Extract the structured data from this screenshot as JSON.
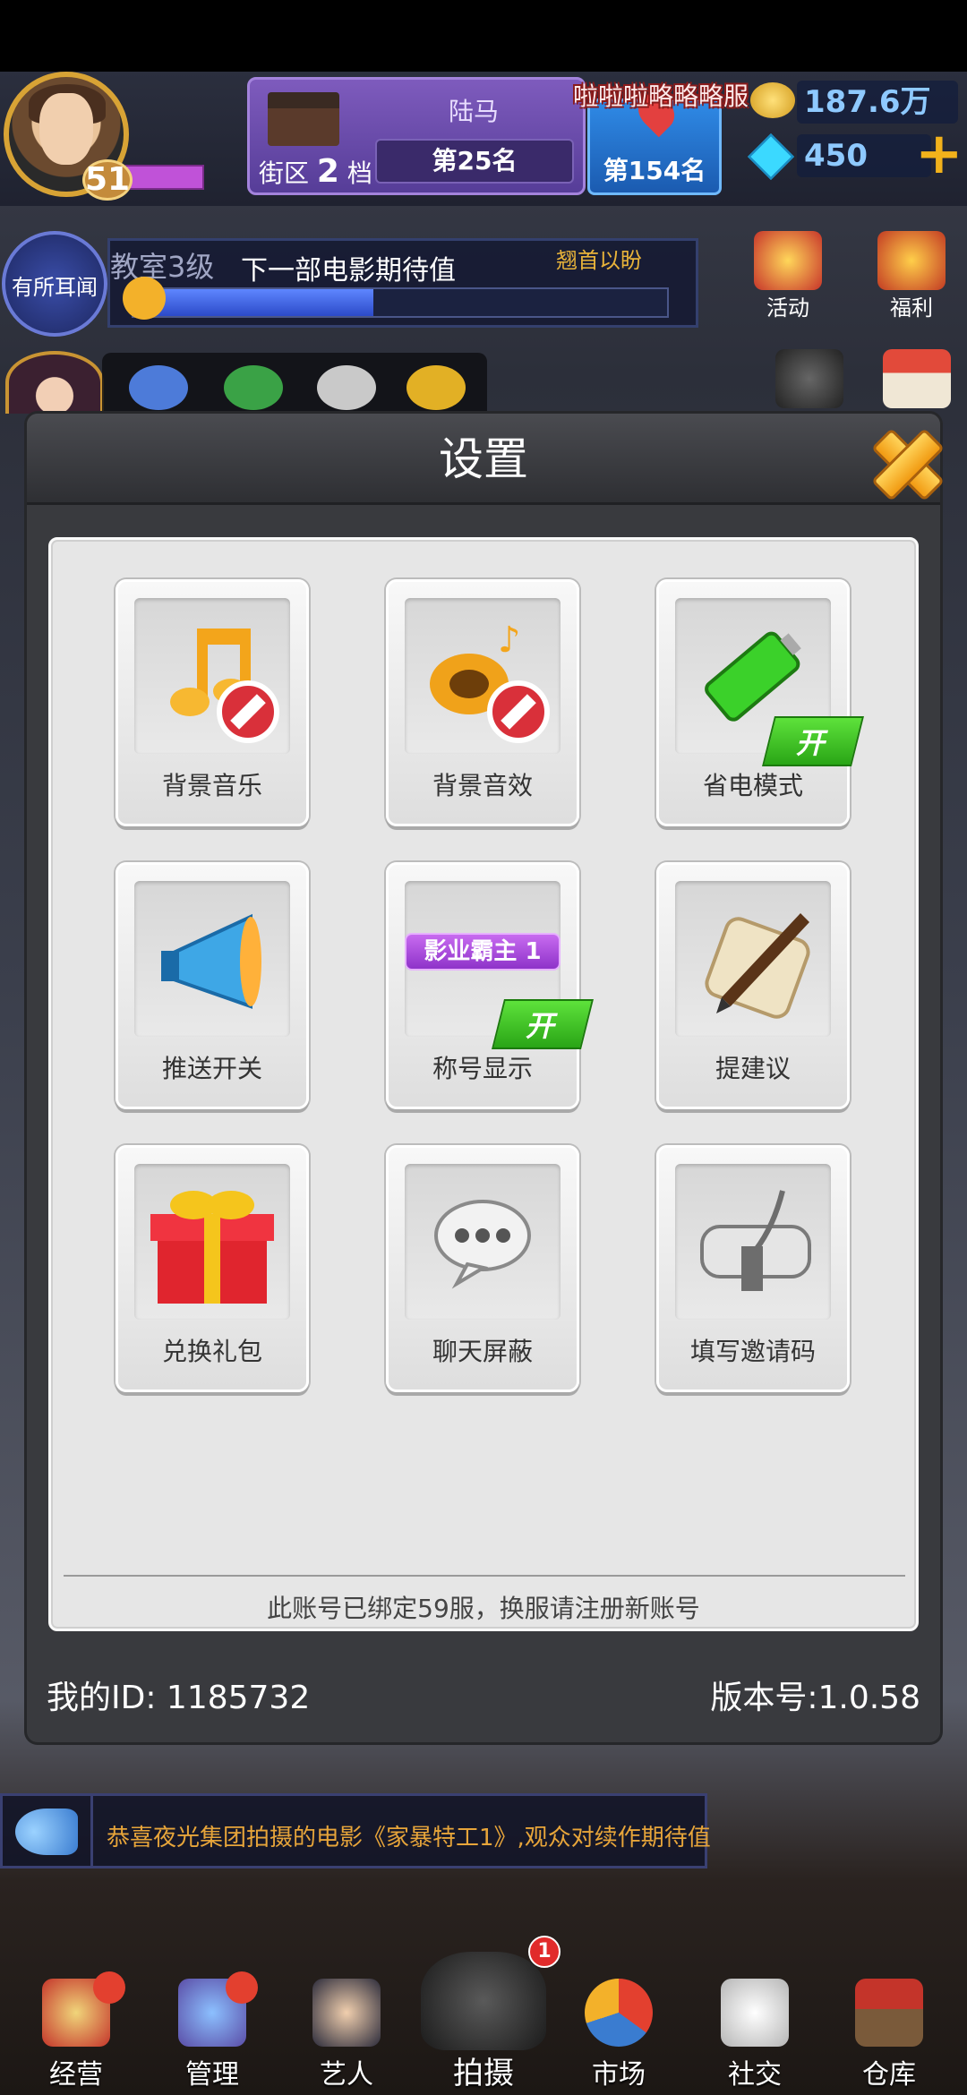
{
  "hud": {
    "level": "51",
    "district_name": "陆马",
    "district_zone": "街区",
    "district_tier": "2",
    "district_tier_unit": "档",
    "district_rank": "第25名",
    "server_name": "啦啦啦略略略服",
    "server_rank": "第154名",
    "gold": "187.6万",
    "diamonds": "450"
  },
  "news": {
    "badge": "有所耳闻",
    "studio": "教室3级",
    "title": "下一部电影期待值",
    "hint": "翘首以盼",
    "progress": 0.45
  },
  "side_buttons": {
    "event": "活动",
    "welfare": "福利"
  },
  "settings": {
    "title": "设置",
    "tiles": [
      {
        "label": "背景音乐",
        "icon": "music-note-icon",
        "state": "off"
      },
      {
        "label": "背景音效",
        "icon": "sound-horn-icon",
        "state": "off"
      },
      {
        "label": "省电模式",
        "icon": "battery-icon",
        "state": "on"
      },
      {
        "label": "推送开关",
        "icon": "megaphone-icon"
      },
      {
        "label": "称号显示",
        "icon": "title-banner-icon",
        "state": "on",
        "banner": "影业霸主 1"
      },
      {
        "label": "提建议",
        "icon": "quill-scroll-icon"
      },
      {
        "label": "兑换礼包",
        "icon": "gift-box-icon"
      },
      {
        "label": "聊天屏蔽",
        "icon": "chat-bubble-icon"
      },
      {
        "label": "填写邀请码",
        "icon": "letter-scroll-icon"
      }
    ],
    "on_label": "开",
    "footnote": "此账号已绑定59服，换服请注册新账号",
    "my_id": "我的ID: 1185732",
    "version": "版本号:1.0.58"
  },
  "ticker": {
    "text": "恭喜夜光集团拍摄的电影《家暴特工1》,观众对续作期待值"
  },
  "nav": {
    "items": [
      "经营",
      "管理",
      "艺人",
      "拍摄",
      "市场",
      "社交",
      "仓库"
    ],
    "shoot_badge": "1"
  },
  "colors": {
    "modal_bg": "#393a3e",
    "panel_bg": "#e6e6e6",
    "on_tag": "#3cc222",
    "close_btn": "#f2a41a",
    "ticker_text": "#e7a53a"
  }
}
